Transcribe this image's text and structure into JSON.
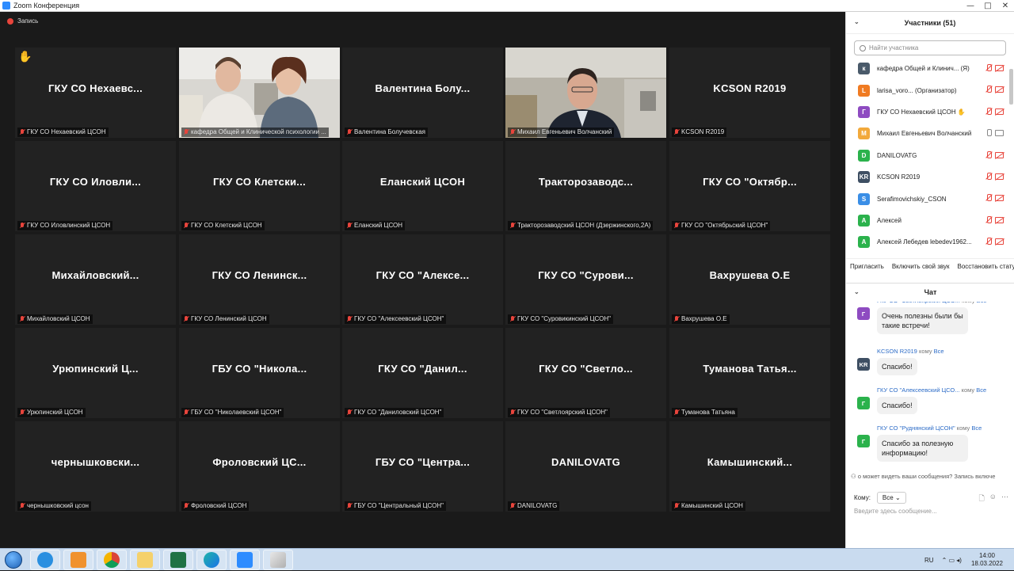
{
  "window": {
    "title": "Zoom Конференция",
    "controls": {
      "minimize": "—",
      "maximize": "□",
      "close": "✕"
    }
  },
  "recording": {
    "label": "Запись"
  },
  "tiles": [
    {
      "name": "ГКУ СО Нехаевс...",
      "label": "ГКУ СО Нехаевский ЦСОН",
      "hand": true
    },
    {
      "name": "",
      "label": "кафедра Общей и Клинической психологии ...",
      "video": "two"
    },
    {
      "name": "Валентина Болу...",
      "label": "Валентина Болучевская"
    },
    {
      "name": "",
      "label": "Михаил Евгеньевич Волчанский",
      "video": "one",
      "active": true
    },
    {
      "name": "KCSON R2019",
      "label": "KCSON R2019"
    },
    {
      "name": "ГКУ СО Иловли...",
      "label": "ГКУ СО Иловлинский ЦСОН"
    },
    {
      "name": "ГКУ СО Клетски...",
      "label": "ГКУ СО Клетский ЦСОН"
    },
    {
      "name": "Еланский ЦСОН",
      "label": "Еланский ЦСОН"
    },
    {
      "name": "Тракторозаводс...",
      "label": "Тракторозаводский ЦСОН (Дзержинского,2А)"
    },
    {
      "name": "ГКУ СО \"Октябр...",
      "label": "ГКУ СО \"Октябрьский ЦСОН\""
    },
    {
      "name": "Михайловский...",
      "label": "Михайловский ЦСОН"
    },
    {
      "name": "ГКУ СО Ленинск...",
      "label": "ГКУ СО Ленинский ЦСОН"
    },
    {
      "name": "ГКУ СО \"Алексе...",
      "label": "ГКУ СО \"Алексеевский ЦСОН\""
    },
    {
      "name": "ГКУ СО \"Сурови...",
      "label": "ГКУ СО \"Суровикинский ЦСОН\""
    },
    {
      "name": "Вахрушева О.Е",
      "label": "Вахрушева О.Е"
    },
    {
      "name": "Урюпинский Ц...",
      "label": "Урюпинский ЦСОН"
    },
    {
      "name": "ГБУ СО \"Никола...",
      "label": "ГБУ СО \"Николаевский ЦСОН\""
    },
    {
      "name": "ГКУ СО \"Данил...",
      "label": "ГКУ СО \"Даниловский ЦСОН\""
    },
    {
      "name": "ГКУ СО \"Светло...",
      "label": "ГКУ СО \"Светлоярский ЦСОН\""
    },
    {
      "name": "Туманова Татья...",
      "label": "Туманова Татьяна"
    },
    {
      "name": "чернышковски...",
      "label": "чернышковский цсон"
    },
    {
      "name": "Фроловский ЦС...",
      "label": "Фроловский ЦСОН"
    },
    {
      "name": "ГБУ СО \"Центра...",
      "label": "ГБУ СО \"Центральный ЦСОН\""
    },
    {
      "name": "DANILOVATG",
      "label": "DANILOVATG"
    },
    {
      "name": "Камышинский...",
      "label": "Камышинский ЦСОН"
    }
  ],
  "participants": {
    "title": "Участники (51)",
    "search_placeholder": "Найти участника",
    "list": [
      {
        "initial": "к",
        "color": "#4a5a6a",
        "name": "кафедра Общей и Клинич... (Я)",
        "mic": "muted",
        "cam": "off"
      },
      {
        "initial": "L",
        "color": "#f07b22",
        "name": "larisa_voro... (Организатор)",
        "mic": "muted",
        "cam": "off"
      },
      {
        "initial": "Г",
        "color": "#8e4bc1",
        "name": "ГКУ СО Нехаевский ЦСОН ✋",
        "mic": "muted",
        "cam": "off"
      },
      {
        "initial": "М",
        "color": "#f2a93b",
        "name": "Михаил Евгеньевич Волчанский",
        "mic": "on",
        "cam": "on"
      },
      {
        "initial": "D",
        "color": "#2bb24c",
        "name": "DANILOVATG",
        "mic": "muted",
        "cam": "off"
      },
      {
        "initial": "KR",
        "color": "#3e4f63",
        "name": "KCSON R2019",
        "mic": "muted",
        "cam": "off"
      },
      {
        "initial": "S",
        "color": "#3a8ee6",
        "name": "Serafimovichskiy_CSON",
        "mic": "muted",
        "cam": "off"
      },
      {
        "initial": "А",
        "color": "#2bb24c",
        "name": "Алексей",
        "mic": "muted",
        "cam": "off"
      },
      {
        "initial": "А",
        "color": "#2bb24c",
        "name": "Алексей Лебедев lebedev1962...",
        "mic": "muted",
        "cam": "off"
      }
    ],
    "actions": [
      "Пригласить",
      "Включить свой звук",
      "Восстановить стату"
    ]
  },
  "chat": {
    "title": "Чат",
    "messages": [
      {
        "sender": "ГКУ СО \"Светлоярский ЦСО...",
        "to_word": "кому",
        "to": "Все",
        "initial": "Г",
        "color": "#8e4bc1",
        "text": "Очень полезны были бы такие встречи!"
      },
      {
        "sender": "KCSON R2019",
        "to_word": "кому",
        "to": "Все",
        "initial": "KR",
        "color": "#3e4f63",
        "text": "Спасибо!"
      },
      {
        "sender": "ГКУ СО \"Алексеевский ЦСО...",
        "to_word": "кому",
        "to": "Все",
        "initial": "Г",
        "color": "#2bb24c",
        "text": "Спасибо!"
      },
      {
        "sender": "ГКУ СО \"Руднянский ЦСОН\"",
        "to_word": "кому",
        "to": "Все",
        "initial": "Г",
        "color": "#2bb24c",
        "text": "Спасибо за полезную информацию!"
      }
    ],
    "privacy": "о может видеть ваши сообщения? Запись включе",
    "to_label": "Кому:",
    "to_value": "Все",
    "input_placeholder": "Введите здесь сообщение..."
  },
  "taskbar": {
    "apps": [
      "internet-explorer",
      "media-player",
      "chrome",
      "file-explorer",
      "excel",
      "edge",
      "zoom",
      "paint"
    ],
    "lang": "RU",
    "time": "14:00",
    "date": "18.03.2022"
  }
}
